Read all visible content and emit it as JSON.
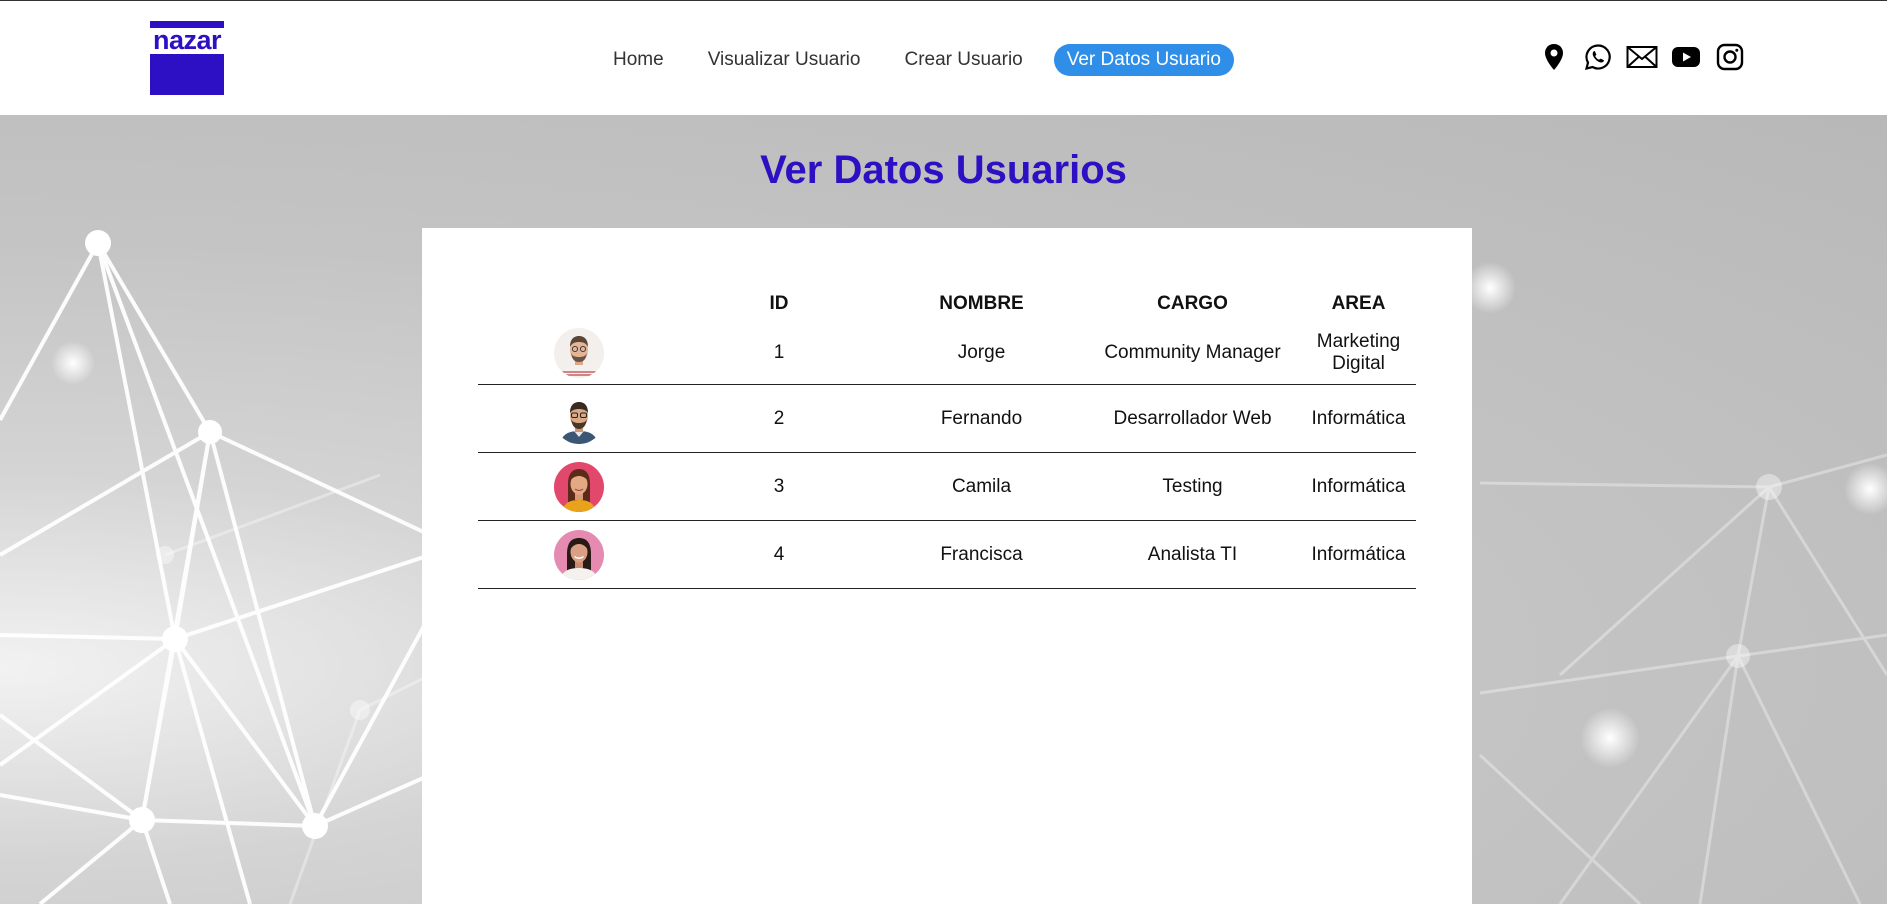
{
  "brand": {
    "logo_text": "nazar",
    "logo_color": "#2d10c4"
  },
  "nav": {
    "items": [
      {
        "label": "Home",
        "active": false
      },
      {
        "label": "Visualizar Usuario",
        "active": false
      },
      {
        "label": "Crear Usuario",
        "active": false
      },
      {
        "label": "Ver Datos Usuario",
        "active": true
      }
    ],
    "active_color": "#2f8ee8"
  },
  "social": [
    "location-pin-icon",
    "whatsapp-icon",
    "mail-icon",
    "youtube-icon",
    "instagram-icon"
  ],
  "page": {
    "title": "Ver Datos Usuarios",
    "title_color": "#2d10c4"
  },
  "table": {
    "headers": [
      "",
      "ID",
      "NOMBRE",
      "CARGO",
      "AREA"
    ],
    "rows": [
      {
        "id": "1",
        "nombre": "Jorge",
        "cargo": "Community Manager",
        "area": "Marketing Digital",
        "avatar": "man-glasses-striped-shirt"
      },
      {
        "id": "2",
        "nombre": "Fernando",
        "cargo": "Desarrollador Web",
        "area": "Informática",
        "avatar": "man-glasses-beard"
      },
      {
        "id": "3",
        "nombre": "Camila",
        "cargo": "Testing",
        "area": "Informática",
        "avatar": "woman-pink-background"
      },
      {
        "id": "4",
        "nombre": "Francisca",
        "cargo": "Analista TI",
        "area": "Informática",
        "avatar": "woman-dark-hair"
      }
    ]
  }
}
